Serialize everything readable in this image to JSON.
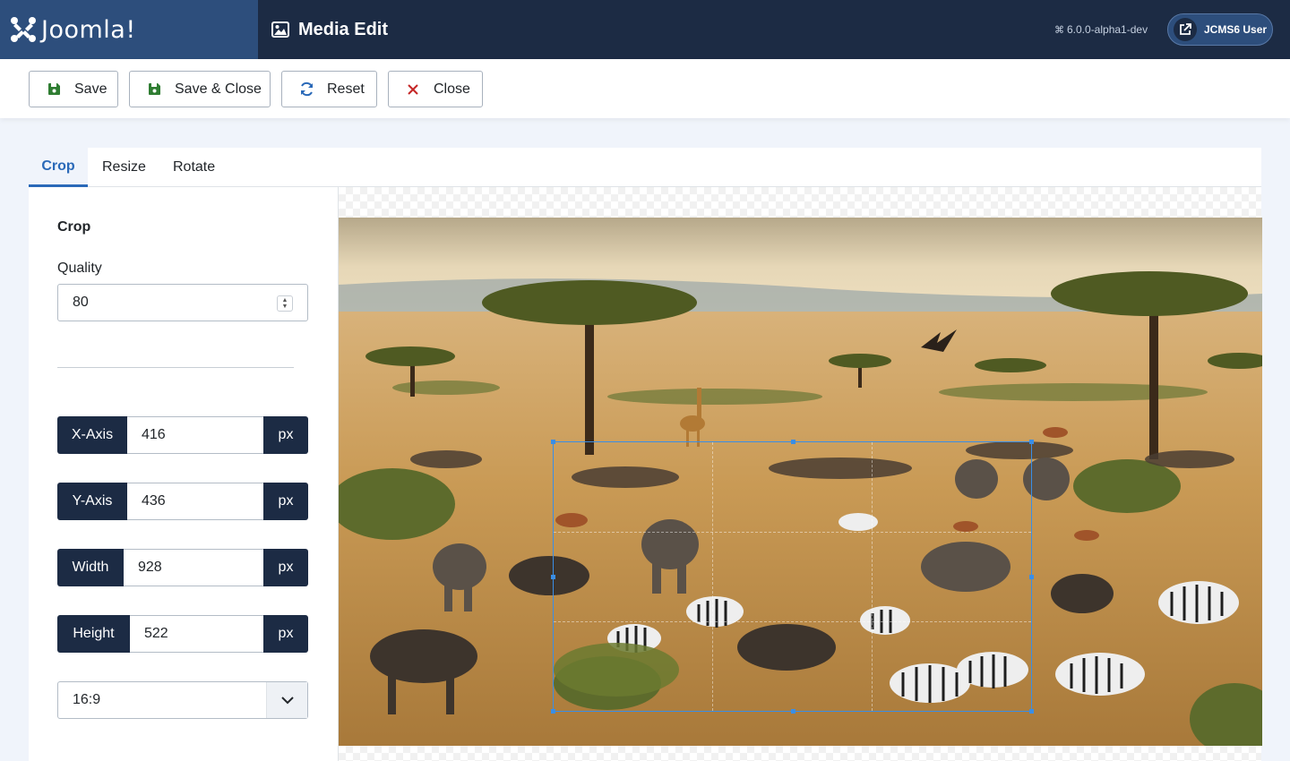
{
  "header": {
    "brand": "Joomla!",
    "page_title": "Media Edit",
    "version": "6.0.0-alpha1-dev",
    "user_label": "JCMS6 User"
  },
  "toolbar": {
    "save": "Save",
    "save_close": "Save & Close",
    "reset": "Reset",
    "close": "Close"
  },
  "tabs": [
    "Crop",
    "Resize",
    "Rotate"
  ],
  "crop_panel": {
    "title": "Crop",
    "quality_label": "Quality",
    "quality_value": "80",
    "fields": [
      {
        "label": "X-Axis",
        "value": "416",
        "unit": "px"
      },
      {
        "label": "Y-Axis",
        "value": "436",
        "unit": "px"
      },
      {
        "label": "Width",
        "value": "928",
        "unit": "px"
      },
      {
        "label": "Height",
        "value": "522",
        "unit": "px"
      }
    ],
    "aspect_ratio": "16:9"
  },
  "colors": {
    "header_bg": "#1c2b44",
    "brand_bg": "#2d4e7c",
    "accent": "#2a69b8",
    "save_icon": "#2f7d32",
    "close_icon": "#c42525",
    "crop_border": "#3a8ee6"
  }
}
